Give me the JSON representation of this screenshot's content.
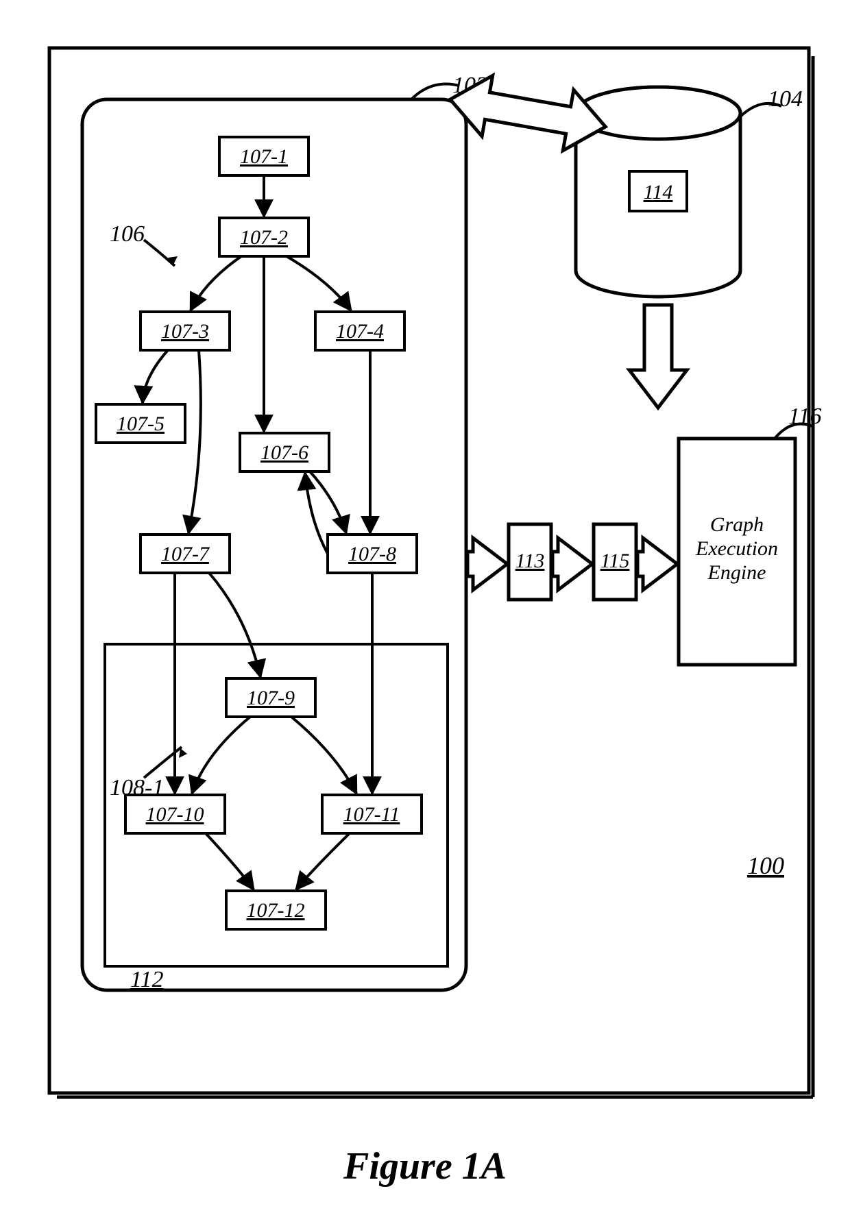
{
  "figure_label": "Figure 1A",
  "system_ref": "100",
  "panel_ref": "102",
  "sub_ref": "106",
  "group_ref": "108-1",
  "group_box_ref": "112",
  "db_ref": "104",
  "db_inner": "114",
  "compiler_a": "113",
  "compiler_b": "115",
  "engine_ref": "116",
  "engine_lines": [
    "Graph",
    "Execution",
    "Engine"
  ],
  "nodes": {
    "n1": "107-1",
    "n2": "107-2",
    "n3": "107-3",
    "n4": "107-4",
    "n5": "107-5",
    "n6": "107-6",
    "n7": "107-7",
    "n8": "107-8",
    "n9": "107-9",
    "n10": "107-10",
    "n11": "107-11",
    "n12": "107-12"
  }
}
